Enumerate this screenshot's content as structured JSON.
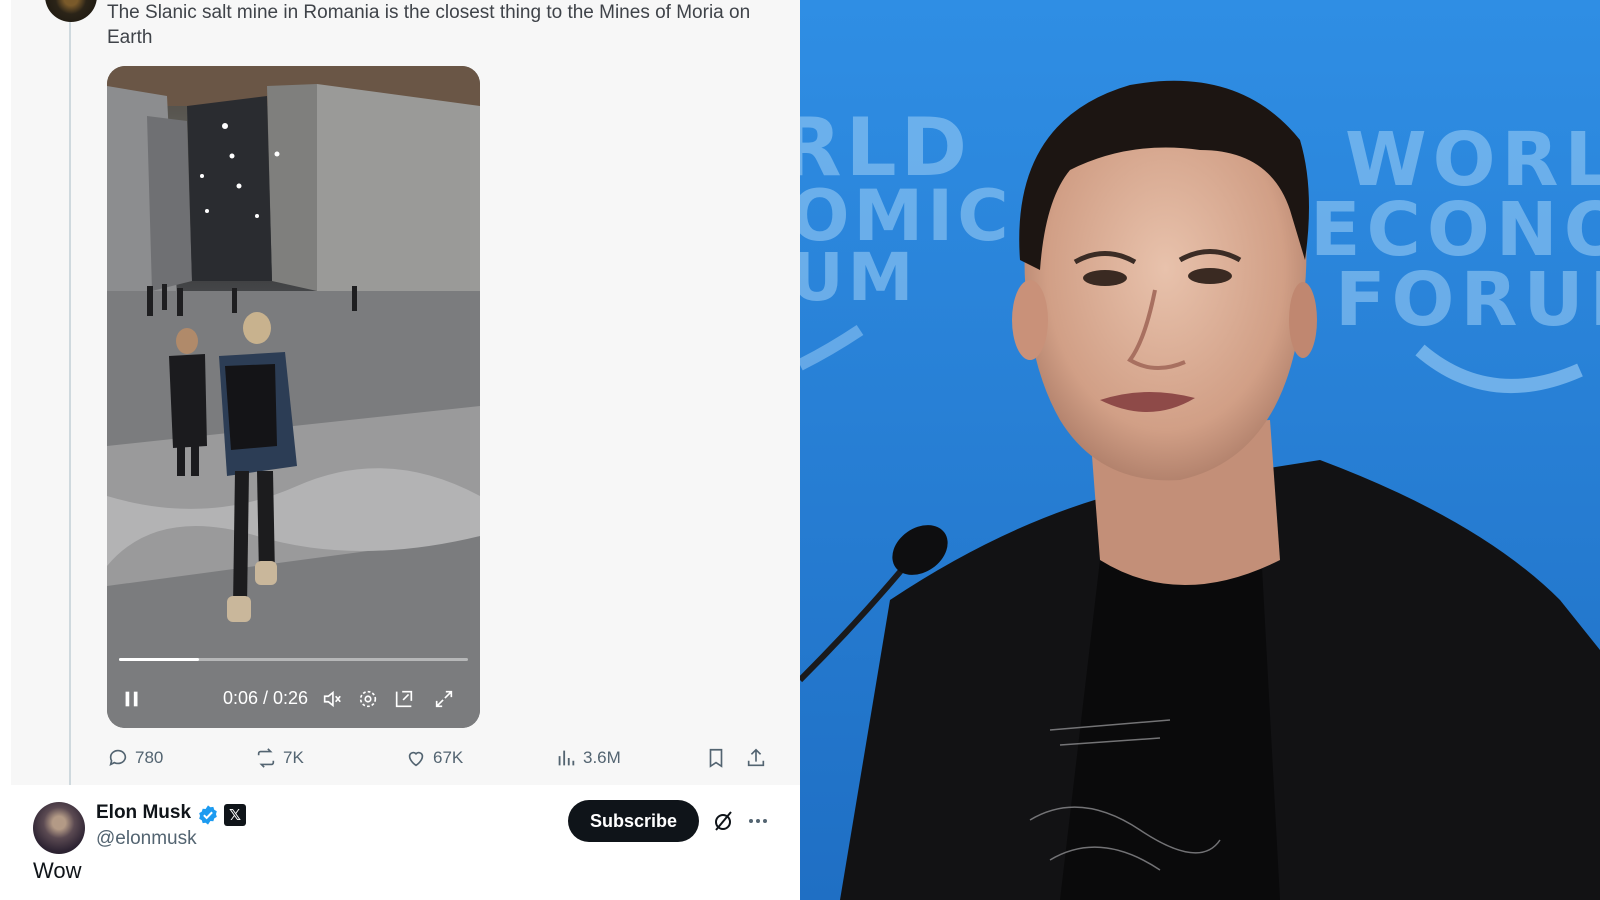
{
  "quoted_tweet": {
    "text": "The Slanic salt mine in Romania is the closest thing to the Mines of Moria on Earth",
    "video": {
      "current_time": "0:06",
      "duration": "0:26",
      "time_display": "0:06 / 0:26",
      "progress_fraction": 0.23,
      "controls": [
        "pause-icon",
        "mute-icon",
        "settings-icon",
        "pip-icon",
        "fullscreen-icon"
      ]
    },
    "stats": {
      "replies": "780",
      "reposts": "7K",
      "likes": "67K",
      "views": "3.6M"
    }
  },
  "reply_tweet": {
    "author_name": "Elon Musk",
    "handle": "@elonmusk",
    "subscribe_label": "Subscribe",
    "affiliate_badge": "𝕏",
    "text": "Wow"
  },
  "photo": {
    "backdrop_text": [
      "WORLD",
      "ECONOMIC",
      "FORUM"
    ],
    "backdrop_color": "#2b86dc"
  },
  "colors": {
    "muted": "#536471",
    "text": "#0f1419",
    "verified": "#1d9bf0"
  }
}
